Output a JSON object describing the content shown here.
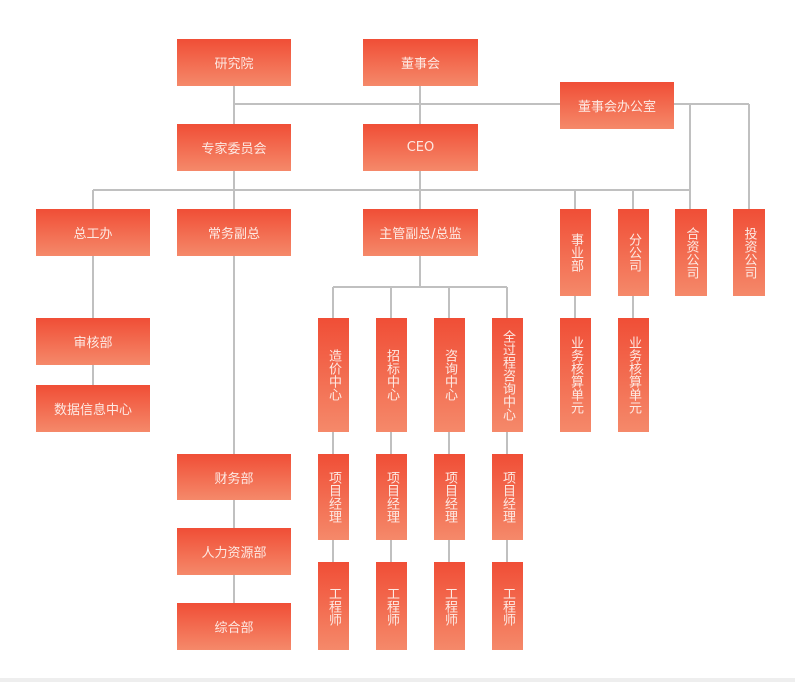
{
  "colors": {
    "box_top": "#f04e36",
    "box_bottom": "#f5896a",
    "line": "#c0c0c0"
  },
  "nodes": {
    "research": "研究院",
    "board": "董事会",
    "board_office": "董事会办公室",
    "expert_committee": "专家委员会",
    "ceo": "CEO",
    "chief_engineer_office": "总工办",
    "executive_vp": "常务副总",
    "supervising_vp": "主管副总/总监",
    "business_division": "事业部",
    "branch": "分公司",
    "joint_venture": "合资公司",
    "investment_company": "投资公司",
    "audit": "审核部",
    "data_center": "数据信息中心",
    "cost_center": "造价中心",
    "bidding_center": "招标中心",
    "consulting_center": "咨询中心",
    "full_process_center": "全过程咨询中心",
    "accounting_unit_1": "业务核算单元",
    "accounting_unit_2": "业务核算单元",
    "pm": "项目经理",
    "engineer": "工程师",
    "finance": "财务部",
    "hr": "人力资源部",
    "general_affairs": "综合部"
  }
}
